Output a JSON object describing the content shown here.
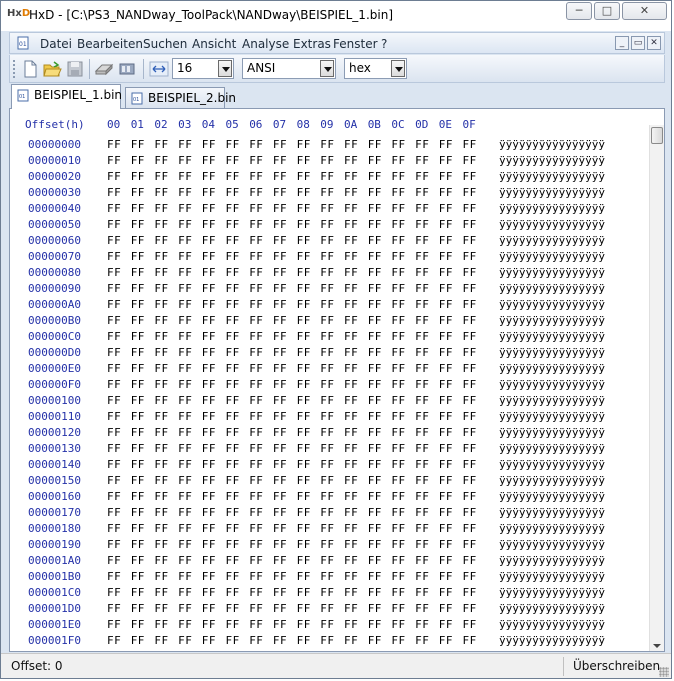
{
  "window": {
    "title": "HxD - [C:\\PS3_NANDway_ToolPack\\NANDway\\BEISPIEL_1.bin]",
    "app_icon_text": "Hx",
    "app_icon_accent": "D",
    "buttons": {
      "minimize": "─",
      "maximize": "□",
      "close": "✕"
    }
  },
  "menu": {
    "items": [
      "Datei",
      "Bearbeiten",
      "Suchen",
      "Ansicht",
      "Analyse",
      "Extras",
      "Fenster",
      "?"
    ],
    "mdi_buttons": [
      "_",
      "▭",
      "✕"
    ]
  },
  "toolbar": {
    "icons": [
      "new-file-icon",
      "open-folder-icon",
      "save-icon",
      "open-disk-icon",
      "open-ram-icon",
      "bytes-per-row-icon"
    ],
    "bytes_per_row": "16",
    "charset": "ANSI",
    "offset_base": "hex"
  },
  "tabs": [
    {
      "label": "BEISPIEL_1.bin",
      "active": true
    },
    {
      "label": "BEISPIEL_2.bin",
      "active": false
    }
  ],
  "editor": {
    "header_offset": "Offset(h)",
    "header_columns": [
      "00",
      "01",
      "02",
      "03",
      "04",
      "05",
      "06",
      "07",
      "08",
      "09",
      "0A",
      "0B",
      "0C",
      "0D",
      "0E",
      "0F"
    ],
    "rows": [
      {
        "offset": "00000000",
        "hex": "FF FF FF FF FF FF FF FF FF FF FF FF FF FF FF FF",
        "ascii": "ÿÿÿÿÿÿÿÿÿÿÿÿÿÿÿÿ"
      },
      {
        "offset": "00000010",
        "hex": "FF FF FF FF FF FF FF FF FF FF FF FF FF FF FF FF",
        "ascii": "ÿÿÿÿÿÿÿÿÿÿÿÿÿÿÿÿ"
      },
      {
        "offset": "00000020",
        "hex": "FF FF FF FF FF FF FF FF FF FF FF FF FF FF FF FF",
        "ascii": "ÿÿÿÿÿÿÿÿÿÿÿÿÿÿÿÿ"
      },
      {
        "offset": "00000030",
        "hex": "FF FF FF FF FF FF FF FF FF FF FF FF FF FF FF FF",
        "ascii": "ÿÿÿÿÿÿÿÿÿÿÿÿÿÿÿÿ"
      },
      {
        "offset": "00000040",
        "hex": "FF FF FF FF FF FF FF FF FF FF FF FF FF FF FF FF",
        "ascii": "ÿÿÿÿÿÿÿÿÿÿÿÿÿÿÿÿ"
      },
      {
        "offset": "00000050",
        "hex": "FF FF FF FF FF FF FF FF FF FF FF FF FF FF FF FF",
        "ascii": "ÿÿÿÿÿÿÿÿÿÿÿÿÿÿÿÿ"
      },
      {
        "offset": "00000060",
        "hex": "FF FF FF FF FF FF FF FF FF FF FF FF FF FF FF FF",
        "ascii": "ÿÿÿÿÿÿÿÿÿÿÿÿÿÿÿÿ"
      },
      {
        "offset": "00000070",
        "hex": "FF FF FF FF FF FF FF FF FF FF FF FF FF FF FF FF",
        "ascii": "ÿÿÿÿÿÿÿÿÿÿÿÿÿÿÿÿ"
      },
      {
        "offset": "00000080",
        "hex": "FF FF FF FF FF FF FF FF FF FF FF FF FF FF FF FF",
        "ascii": "ÿÿÿÿÿÿÿÿÿÿÿÿÿÿÿÿ"
      },
      {
        "offset": "00000090",
        "hex": "FF FF FF FF FF FF FF FF FF FF FF FF FF FF FF FF",
        "ascii": "ÿÿÿÿÿÿÿÿÿÿÿÿÿÿÿÿ"
      },
      {
        "offset": "000000A0",
        "hex": "FF FF FF FF FF FF FF FF FF FF FF FF FF FF FF FF",
        "ascii": "ÿÿÿÿÿÿÿÿÿÿÿÿÿÿÿÿ"
      },
      {
        "offset": "000000B0",
        "hex": "FF FF FF FF FF FF FF FF FF FF FF FF FF FF FF FF",
        "ascii": "ÿÿÿÿÿÿÿÿÿÿÿÿÿÿÿÿ"
      },
      {
        "offset": "000000C0",
        "hex": "FF FF FF FF FF FF FF FF FF FF FF FF FF FF FF FF",
        "ascii": "ÿÿÿÿÿÿÿÿÿÿÿÿÿÿÿÿ"
      },
      {
        "offset": "000000D0",
        "hex": "FF FF FF FF FF FF FF FF FF FF FF FF FF FF FF FF",
        "ascii": "ÿÿÿÿÿÿÿÿÿÿÿÿÿÿÿÿ"
      },
      {
        "offset": "000000E0",
        "hex": "FF FF FF FF FF FF FF FF FF FF FF FF FF FF FF FF",
        "ascii": "ÿÿÿÿÿÿÿÿÿÿÿÿÿÿÿÿ"
      },
      {
        "offset": "000000F0",
        "hex": "FF FF FF FF FF FF FF FF FF FF FF FF FF FF FF FF",
        "ascii": "ÿÿÿÿÿÿÿÿÿÿÿÿÿÿÿÿ"
      },
      {
        "offset": "00000100",
        "hex": "FF FF FF FF FF FF FF FF FF FF FF FF FF FF FF FF",
        "ascii": "ÿÿÿÿÿÿÿÿÿÿÿÿÿÿÿÿ"
      },
      {
        "offset": "00000110",
        "hex": "FF FF FF FF FF FF FF FF FF FF FF FF FF FF FF FF",
        "ascii": "ÿÿÿÿÿÿÿÿÿÿÿÿÿÿÿÿ"
      },
      {
        "offset": "00000120",
        "hex": "FF FF FF FF FF FF FF FF FF FF FF FF FF FF FF FF",
        "ascii": "ÿÿÿÿÿÿÿÿÿÿÿÿÿÿÿÿ"
      },
      {
        "offset": "00000130",
        "hex": "FF FF FF FF FF FF FF FF FF FF FF FF FF FF FF FF",
        "ascii": "ÿÿÿÿÿÿÿÿÿÿÿÿÿÿÿÿ"
      },
      {
        "offset": "00000140",
        "hex": "FF FF FF FF FF FF FF FF FF FF FF FF FF FF FF FF",
        "ascii": "ÿÿÿÿÿÿÿÿÿÿÿÿÿÿÿÿ"
      },
      {
        "offset": "00000150",
        "hex": "FF FF FF FF FF FF FF FF FF FF FF FF FF FF FF FF",
        "ascii": "ÿÿÿÿÿÿÿÿÿÿÿÿÿÿÿÿ"
      },
      {
        "offset": "00000160",
        "hex": "FF FF FF FF FF FF FF FF FF FF FF FF FF FF FF FF",
        "ascii": "ÿÿÿÿÿÿÿÿÿÿÿÿÿÿÿÿ"
      },
      {
        "offset": "00000170",
        "hex": "FF FF FF FF FF FF FF FF FF FF FF FF FF FF FF FF",
        "ascii": "ÿÿÿÿÿÿÿÿÿÿÿÿÿÿÿÿ"
      },
      {
        "offset": "00000180",
        "hex": "FF FF FF FF FF FF FF FF FF FF FF FF FF FF FF FF",
        "ascii": "ÿÿÿÿÿÿÿÿÿÿÿÿÿÿÿÿ"
      },
      {
        "offset": "00000190",
        "hex": "FF FF FF FF FF FF FF FF FF FF FF FF FF FF FF FF",
        "ascii": "ÿÿÿÿÿÿÿÿÿÿÿÿÿÿÿÿ"
      },
      {
        "offset": "000001A0",
        "hex": "FF FF FF FF FF FF FF FF FF FF FF FF FF FF FF FF",
        "ascii": "ÿÿÿÿÿÿÿÿÿÿÿÿÿÿÿÿ"
      },
      {
        "offset": "000001B0",
        "hex": "FF FF FF FF FF FF FF FF FF FF FF FF FF FF FF FF",
        "ascii": "ÿÿÿÿÿÿÿÿÿÿÿÿÿÿÿÿ"
      },
      {
        "offset": "000001C0",
        "hex": "FF FF FF FF FF FF FF FF FF FF FF FF FF FF FF FF",
        "ascii": "ÿÿÿÿÿÿÿÿÿÿÿÿÿÿÿÿ"
      },
      {
        "offset": "000001D0",
        "hex": "FF FF FF FF FF FF FF FF FF FF FF FF FF FF FF FF",
        "ascii": "ÿÿÿÿÿÿÿÿÿÿÿÿÿÿÿÿ"
      },
      {
        "offset": "000001E0",
        "hex": "FF FF FF FF FF FF FF FF FF FF FF FF FF FF FF FF",
        "ascii": "ÿÿÿÿÿÿÿÿÿÿÿÿÿÿÿÿ"
      },
      {
        "offset": "000001F0",
        "hex": "FF FF FF FF FF FF FF FF FF FF FF FF FF FF FF FF",
        "ascii": "ÿÿÿÿÿÿÿÿÿÿÿÿÿÿÿÿ"
      }
    ]
  },
  "status": {
    "offset": "Offset: 0",
    "mode": "Überschreiben"
  },
  "colors": {
    "offset_text": "#2431a8",
    "chrome_bg": "#dbe5f1"
  }
}
